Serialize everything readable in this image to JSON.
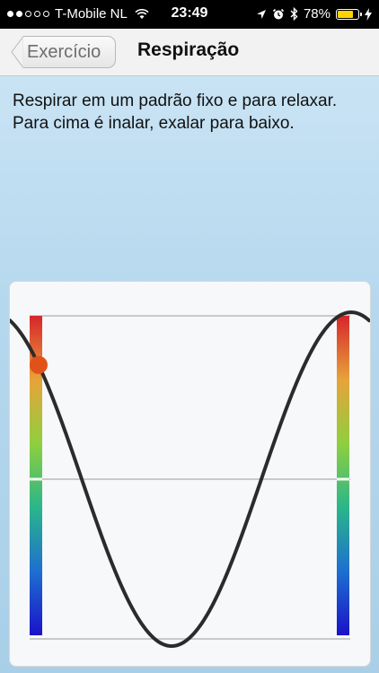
{
  "status_bar": {
    "carrier": "T-Mobile NL",
    "signal_bars_filled": 2,
    "signal_bars_total": 5,
    "time": "23:49",
    "battery_percent": "78%",
    "battery_level": 0.78,
    "battery_color": "#ffd400"
  },
  "nav": {
    "back_label": "Exercício",
    "title": "Respiração"
  },
  "instructions": "Respirar em um padrão fixo e para relaxar. Para cima é inalar, exalar para baixo.",
  "breathing_chart": {
    "curve_color": "#2b2b2b",
    "indicator_color": "#e0521a",
    "scale_colors": [
      "#d7262b",
      "#e7a33a",
      "#8fcf3e",
      "#2ab68a",
      "#1e6fd0",
      "#1a12c8"
    ],
    "indicator_phase": 0.38
  }
}
